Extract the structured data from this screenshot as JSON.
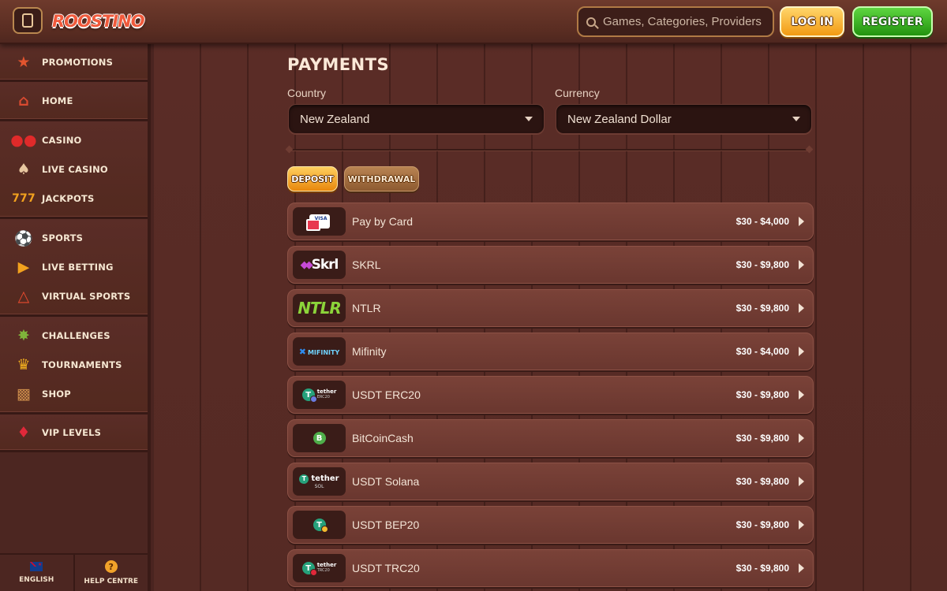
{
  "header": {
    "logo_text": "ROOSTINO",
    "search_placeholder": "Games, Categories, Providers",
    "login_label": "LOG IN",
    "register_label": "REGISTER"
  },
  "sidebar": {
    "groups": [
      [
        {
          "label": "PROMOTIONS",
          "icon": "gift-icon"
        }
      ],
      [
        {
          "label": "HOME",
          "icon": "barn-icon"
        }
      ],
      [
        {
          "label": "CASINO",
          "icon": "cherry-icon"
        },
        {
          "label": "LIVE CASINO",
          "icon": "cards-icon"
        },
        {
          "label": "JACKPOTS",
          "icon": "seven-icon"
        }
      ],
      [
        {
          "label": "SPORTS",
          "icon": "soccer-ball-icon"
        },
        {
          "label": "LIVE BETTING",
          "icon": "play-icon"
        },
        {
          "label": "VIRTUAL SPORTS",
          "icon": "joystick-icon"
        }
      ],
      [
        {
          "label": "CHALLENGES",
          "icon": "star-badge-icon"
        },
        {
          "label": "TOURNAMENTS",
          "icon": "trophy-icon"
        },
        {
          "label": "SHOP",
          "icon": "basket-icon"
        }
      ],
      [
        {
          "label": "VIP LEVELS",
          "icon": "gem-icon"
        }
      ]
    ],
    "footer": {
      "language": "ENGLISH",
      "help": "HELP CENTRE"
    }
  },
  "main": {
    "title": "PAYMENTS",
    "country_label": "Country",
    "country_value": "New Zealand",
    "currency_label": "Currency",
    "currency_value": "New Zealand Dollar",
    "tabs": {
      "deposit": "DEPOSIT",
      "withdrawal": "WITHDRAWAL"
    },
    "methods": [
      {
        "name": "Pay by Card",
        "range": "$30 - $4,000",
        "logo": "card",
        "logo_text": "VISA"
      },
      {
        "name": "SKRL",
        "range": "$30 - $9,800",
        "logo": "skrl",
        "logo_text": "Skrl"
      },
      {
        "name": "NTLR",
        "range": "$30 - $9,800",
        "logo": "ntlr",
        "logo_text": "NTLR"
      },
      {
        "name": "Mifinity",
        "range": "$30 - $4,000",
        "logo": "mifinity",
        "logo_text": "MIFINITY"
      },
      {
        "name": "USDT ERC20",
        "range": "$30 - $9,800",
        "logo": "tether-erc",
        "logo_text": "tether",
        "logo_sub": "ERC20"
      },
      {
        "name": "BitCoinCash",
        "range": "$30 - $9,800",
        "logo": "bch",
        "logo_text": "B"
      },
      {
        "name": "USDT Solana",
        "range": "$30 - $9,800",
        "logo": "tether-sol",
        "logo_text": "tether",
        "logo_sub": "SOL"
      },
      {
        "name": "USDT BEP20",
        "range": "$30 - $9,800",
        "logo": "tether-bep",
        "logo_text": "T"
      },
      {
        "name": "USDT TRC20",
        "range": "$30 - $9,800",
        "logo": "tether-trc",
        "logo_text": "tether",
        "logo_sub": "TRC20"
      }
    ]
  },
  "colors": {
    "login": "#f29a12",
    "register": "#22920f",
    "background": "#4a2420"
  }
}
